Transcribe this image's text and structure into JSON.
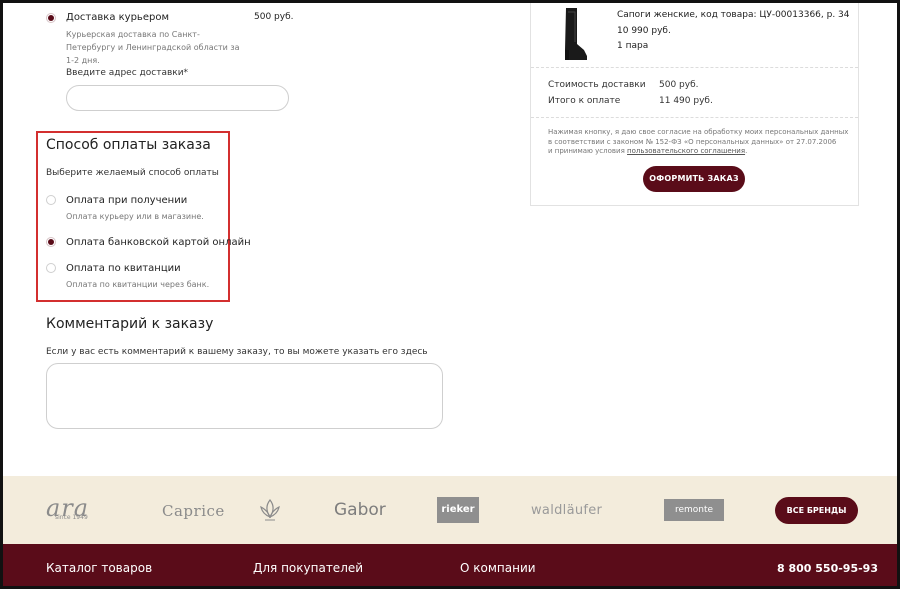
{
  "delivery": {
    "courier_label": "Доставка курьером",
    "courier_price": "500 руб.",
    "courier_desc": [
      "Курьерская доставка по Санкт-",
      "Петербургу и Ленинградской области за",
      "1-2 дня."
    ],
    "address_label": "Введите адрес доставки*",
    "address_value": ""
  },
  "payment": {
    "title": "Способ оплаты заказа",
    "subtitle": "Выберите желаемый способ оплаты",
    "options": [
      {
        "label": "Оплата при получении",
        "desc": "Оплата курьеру или в магазине.",
        "checked": false
      },
      {
        "label": "Оплата банковской картой онлайн",
        "desc": "",
        "checked": true
      },
      {
        "label": "Оплата по квитанции",
        "desc": "Оплата по квитанции через банк.",
        "checked": false
      }
    ]
  },
  "comment": {
    "title": "Комментарий к заказу",
    "hint": "Если у вас есть комментарий к вашему заказу, то вы можете указать его здесь",
    "value": ""
  },
  "summary": {
    "product_name": "Сапоги женские, код товара: ЦУ-00013366, р. 34",
    "product_price": "10 990 руб.",
    "product_qty": "1 пара",
    "delivery_cost_label": "Стоимость доставки",
    "delivery_cost_value": "500 руб.",
    "total_label": "Итого к оплате",
    "total_value": "11 490 руб.",
    "consent_line1": "Нажимая кнопку, я даю свое согласие на обработку моих персональных данных",
    "consent_line2": "в соответствии с законом № 152-ФЗ «О персональных данных» от 27.07.2006",
    "consent_line3": "и принимаю условия ",
    "consent_link": "пользовательского соглашения",
    "consent_end": ".",
    "order_button": "ОФОРМИТЬ ЗАКАЗ"
  },
  "brands": {
    "logos": [
      "ara",
      "since 1949",
      "Caprice",
      "Gabor",
      "rieker",
      "waldläufer",
      "remonte"
    ],
    "all_brands_button": "ВСЕ БРЕНДЫ"
  },
  "footer": {
    "catalog": "Каталог товаров",
    "customers": "Для покупателей",
    "about": "О компании",
    "phone": "8 800 550-95-93"
  },
  "colors": {
    "accent": "#5a0c19",
    "highlight": "#d32f2f",
    "brands_bg": "#f3ecdc"
  }
}
